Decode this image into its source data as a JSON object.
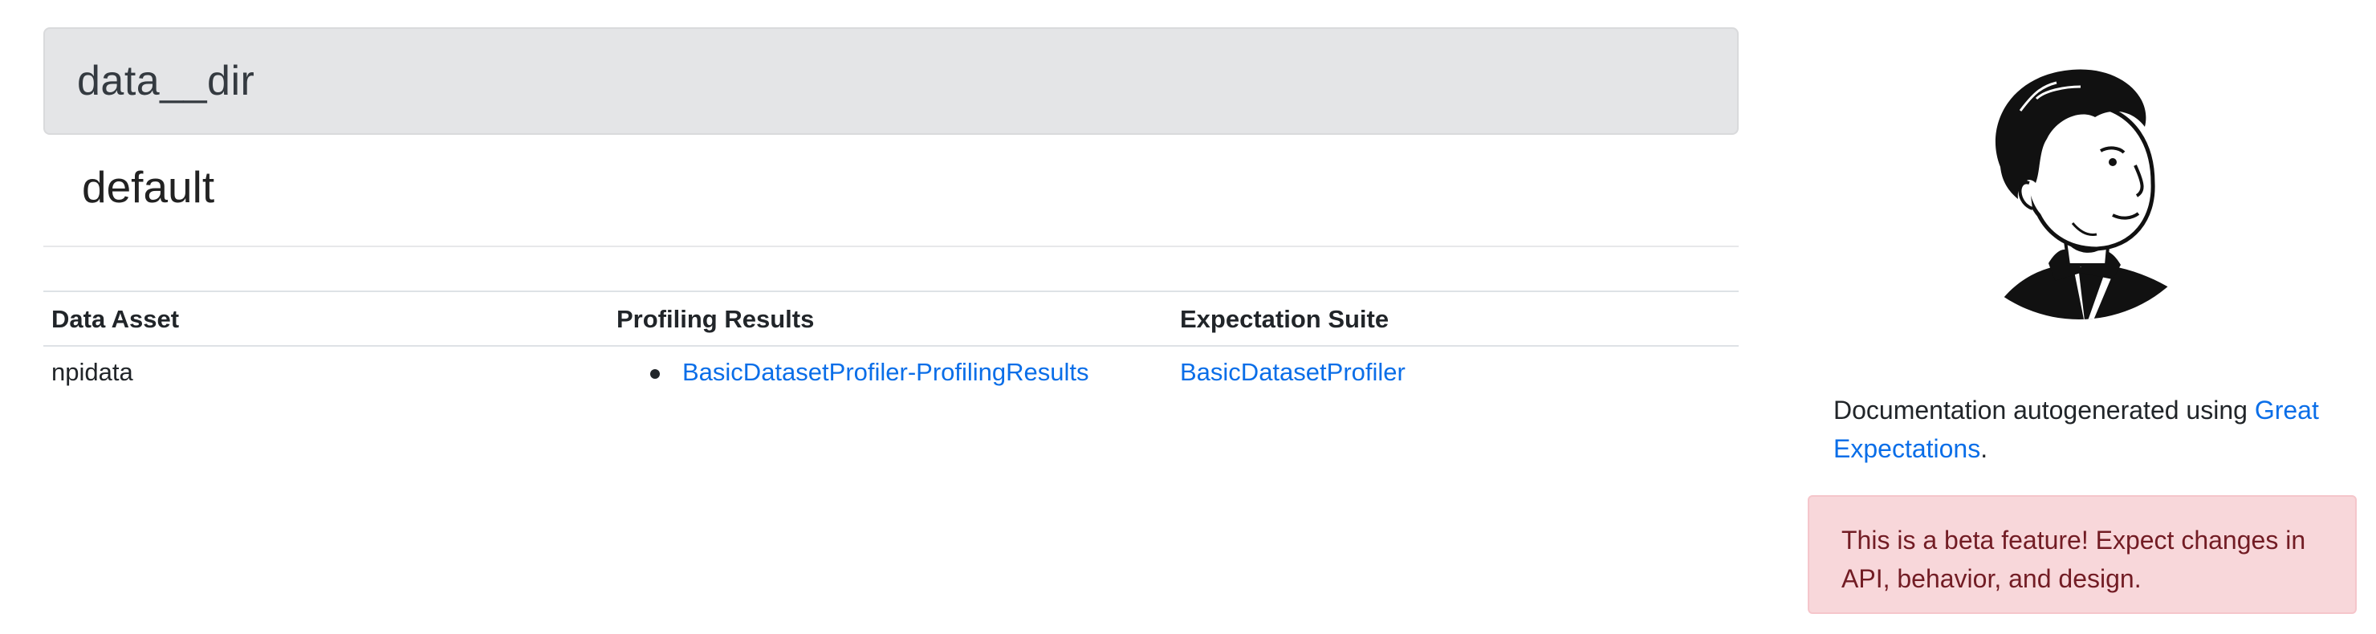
{
  "header": {
    "title": "data__dir"
  },
  "section": {
    "title": "default"
  },
  "table": {
    "headers": [
      "Data Asset",
      "Profiling Results",
      "Expectation Suite"
    ],
    "rows": [
      {
        "asset": "npidata",
        "profiling_results": [
          "BasicDatasetProfiler-ProfilingResults"
        ],
        "expectation_suite": "BasicDatasetProfiler"
      }
    ]
  },
  "sidebar": {
    "logo_icon": "great-expectations-logo-icon",
    "doc_text": "Documentation autogenerated using ",
    "doc_link": "Great Expectations",
    "doc_suffix": ".",
    "beta_notice": "This is a beta feature! Expect changes in API, behavior, and design."
  },
  "colors": {
    "link": "#0a6ee8",
    "jumbotron_bg": "#e4e5e7",
    "alert_bg": "#f8d7da",
    "alert_text": "#721c24"
  }
}
